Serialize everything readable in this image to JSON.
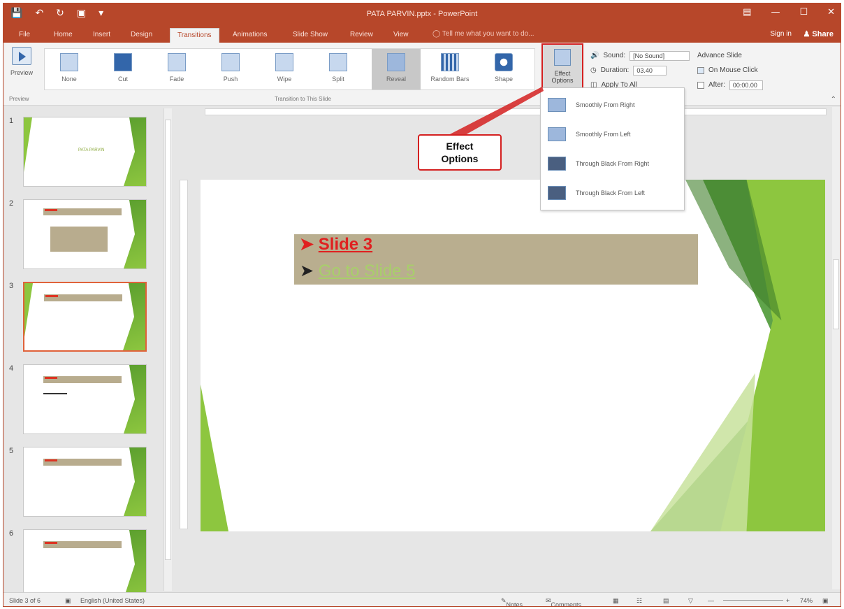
{
  "titlebar": {
    "title": "PATA PARVIN.pptx - PowerPoint"
  },
  "tabs": [
    "File",
    "Home",
    "Insert",
    "Design",
    "Transitions",
    "Animations",
    "Slide Show",
    "Review",
    "View"
  ],
  "tell_me": "Tell me what you want to do...",
  "sign_in": "Sign in",
  "share": "Share",
  "ribbon": {
    "preview_label": "Preview",
    "preview_group": "Preview",
    "transitions": [
      "None",
      "Cut",
      "Fade",
      "Push",
      "Wipe",
      "Split",
      "Reveal",
      "Random Bars",
      "Shape"
    ],
    "transition_group": "Transition to This Slide",
    "effect_options": "Effect Options",
    "sound_label": "Sound:",
    "sound_value": "[No Sound]",
    "duration_label": "Duration:",
    "duration_value": "03.40",
    "apply_all": "Apply To All",
    "advance_title": "Advance Slide",
    "on_mouse_click": "On Mouse Click",
    "after_label": "After:",
    "after_value": "00:00.00"
  },
  "dropdown": [
    "Smoothly From Right",
    "Smoothly From Left",
    "Through Black From Right",
    "Through Black From Left"
  ],
  "callout": {
    "line1": "Effect",
    "line2": "Options"
  },
  "thumbnails": {
    "numbers": [
      "1",
      "2",
      "3",
      "4",
      "5",
      "6"
    ],
    "slide1_title": "PATA PARVIN"
  },
  "slide": {
    "bullet1": "Slide 3",
    "bullet2": "Go to Slide 5"
  },
  "status": {
    "slide_count": "Slide 3 of 6",
    "language": "English (United States)",
    "notes": "Notes",
    "comments": "Comments",
    "zoom": "74%"
  },
  "colors": {
    "accent": "#b7472a",
    "highlight": "#d42020",
    "slide_green": "#8dc63f"
  }
}
